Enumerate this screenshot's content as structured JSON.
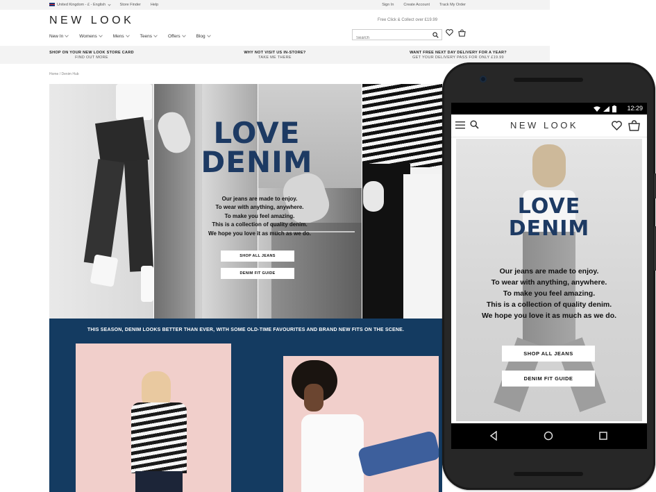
{
  "desktop": {
    "utility": {
      "locale": "United Kingdom - £ - English",
      "store_finder": "Store Finder",
      "help": "Help",
      "sign_in": "Sign In",
      "create_account": "Create Account",
      "track_order": "Track My Order"
    },
    "logo": "NEW LOOK",
    "promo_note": "Free Click & Collect over £19.99",
    "nav": [
      "New In",
      "Womens",
      "Mens",
      "Teens",
      "Offers",
      "Blog"
    ],
    "search_placeholder": "Search",
    "usps": [
      {
        "title": "SHOP ON YOUR NEW LOOK STORE CARD",
        "link": "FIND OUT MORE"
      },
      {
        "title": "WHY NOT VISIT US IN-STORE?",
        "link": "TAKE ME THERE"
      },
      {
        "title": "WANT FREE NEXT DAY DELIVERY FOR A YEAR?",
        "link": "GET YOUR DELIVERY PASS FOR ONLY £19.99"
      }
    ],
    "breadcrumb": {
      "home": "Home",
      "sep": "/",
      "current": "Denim Hub"
    },
    "hero": {
      "title_line1": "LOVE",
      "title_line2": "DENIM",
      "copy": [
        "Our jeans are made to enjoy.",
        "To wear with anything, anywhere.",
        "To make you feel amazing.",
        "This is a collection of quality denim.",
        "We hope you love it as much as we do."
      ],
      "btn_shop": "SHOP ALL JEANS",
      "btn_fit": "DENIM FIT GUIDE"
    },
    "section_headline": "THIS SEASON, DENIM LOOKS BETTER THAN EVER, WITH SOME OLD-TIME FAVOURITES AND BRAND NEW FITS ON THE SCENE.",
    "colors": {
      "navy": "#143b61",
      "title_blue": "#1d3a63",
      "card_pink": "#f1cfcb"
    }
  },
  "mobile": {
    "status_time": "12:29",
    "logo": "NEW LOOK",
    "title_line1": "LOVE",
    "title_line2": "DENIM",
    "copy": [
      "Our jeans are made to enjoy.",
      "To wear with anything, anywhere.",
      "To make you feel amazing.",
      "This is a collection of quality denim.",
      "We hope you love it as much as we do."
    ],
    "btn_shop": "SHOP ALL JEANS",
    "btn_fit": "DENIM FIT GUIDE",
    "icons": [
      "menu-icon",
      "search-icon",
      "heart-icon",
      "bag-icon",
      "back-icon",
      "home-icon",
      "recents-icon"
    ]
  }
}
